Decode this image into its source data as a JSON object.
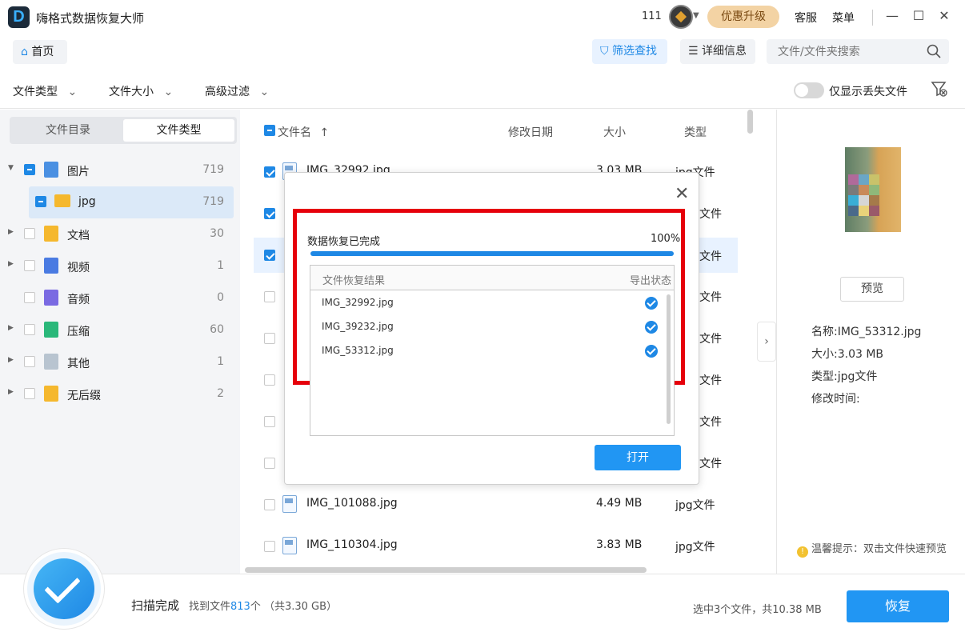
{
  "titlebar": {
    "app_title": "嗨格式数据恢复大师",
    "count": "111",
    "upgrade": "优惠升级",
    "service": "客服",
    "menu": "菜单",
    "minimize": "—",
    "maximize": "☐",
    "close": "✕"
  },
  "toolbar": {
    "home": "首页",
    "filter_search": "筛选查找",
    "details": "详细信息",
    "search_placeholder": "文件/文件夹搜索"
  },
  "filters": {
    "file_type": "文件类型",
    "file_size": "文件大小",
    "advanced": "高级过滤",
    "only_lost": "仅显示丢失文件"
  },
  "sidebar": {
    "tabs": [
      "文件目录",
      "文件类型"
    ],
    "items": [
      {
        "label": "图片",
        "count": "719",
        "color": "#4a90e2"
      },
      {
        "label": "jpg",
        "count": "719",
        "color": "#f5b82e"
      },
      {
        "label": "文档",
        "count": "30",
        "color": "#f5b82e"
      },
      {
        "label": "视频",
        "count": "1",
        "color": "#4a7be2"
      },
      {
        "label": "音频",
        "count": "0",
        "color": "#7a6ae2"
      },
      {
        "label": "压缩",
        "count": "60",
        "color": "#2ab87a"
      },
      {
        "label": "其他",
        "count": "1",
        "color": "#b8c4d0"
      },
      {
        "label": "无后缀",
        "count": "2",
        "color": "#f5b82e"
      }
    ]
  },
  "filelist": {
    "headers": {
      "name": "文件名",
      "sort": "↑",
      "date": "修改日期",
      "size": "大小",
      "type": "类型"
    },
    "rows": [
      {
        "name": "IMG_32992.jpg",
        "size": "3.03 MB",
        "type": "jpg文件"
      },
      {
        "name": "",
        "size": "",
        "type": "文件"
      },
      {
        "name": "",
        "size": "",
        "type": "文件"
      },
      {
        "name": "",
        "size": "",
        "type": "文件"
      },
      {
        "name": "",
        "size": "",
        "type": "文件"
      },
      {
        "name": "",
        "size": "",
        "type": "文件"
      },
      {
        "name": "",
        "size": "",
        "type": "文件"
      },
      {
        "name": "",
        "size": "",
        "type": "文件"
      },
      {
        "name": "IMG_101088.jpg",
        "size": "4.49 MB",
        "type": "jpg文件"
      },
      {
        "name": "IMG_110304.jpg",
        "size": "3.83 MB",
        "type": "jpg文件"
      }
    ]
  },
  "preview": {
    "button": "预览",
    "name": "名称:IMG_53312.jpg",
    "size": "大小:3.03 MB",
    "type": "类型:jpg文件",
    "mtime": "修改时间:",
    "tip": "温馨提示：双击文件快速预览"
  },
  "status": {
    "scan_done": "扫描完成",
    "found_prefix": "找到文件",
    "found_count": "813",
    "found_suffix": "个 （共3.30 GB）",
    "selection": "选中3个文件，共10.38 MB",
    "recover": "恢复"
  },
  "dialog": {
    "title": "数据恢复已完成",
    "progress_text": "100%",
    "progress": 1.0,
    "col_result": "文件恢复结果",
    "col_status": "导出状态",
    "results": [
      "IMG_32992.jpg",
      "IMG_39232.jpg",
      "IMG_53312.jpg"
    ],
    "open": "打开"
  }
}
